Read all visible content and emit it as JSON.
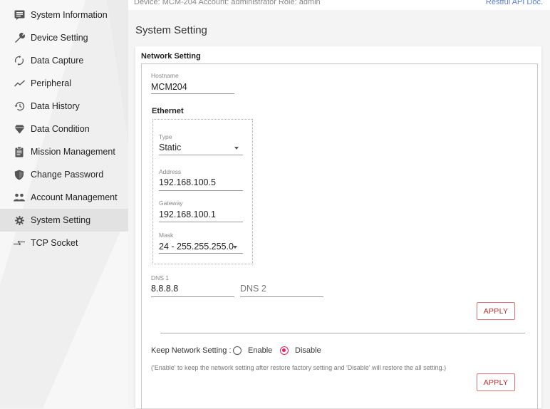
{
  "topbar": {
    "info": "Device: MCM-204   Account: administrator   Role: admin",
    "api_link": "Restful API Doc."
  },
  "sidebar": {
    "items": [
      {
        "label": "System Information",
        "icon": "info-panel-icon"
      },
      {
        "label": "Device Setting",
        "icon": "wrench-icon"
      },
      {
        "label": "Data Capture",
        "icon": "sync-icon"
      },
      {
        "label": "Peripheral",
        "icon": "line-chart-icon"
      },
      {
        "label": "Data History",
        "icon": "history-icon"
      },
      {
        "label": "Data Condition",
        "icon": "diamond-icon"
      },
      {
        "label": "Mission Management",
        "icon": "clipboard-icon"
      },
      {
        "label": "Change Password",
        "icon": "shield-icon"
      },
      {
        "label": "Account Management",
        "icon": "users-icon"
      },
      {
        "label": "System Setting",
        "icon": "gear-icon",
        "active": true
      },
      {
        "label": "TCP Socket",
        "icon": "arrows-icon"
      }
    ]
  },
  "page": {
    "title": "System Setting"
  },
  "network": {
    "section_title": "Network Setting",
    "hostname": {
      "label": "Hostname",
      "value": "MCM204"
    },
    "ethernet": {
      "title": "Ethernet",
      "type": {
        "label": "Type",
        "value": "Static"
      },
      "address": {
        "label": "Address",
        "value": "192.168.100.5"
      },
      "gateway": {
        "label": "Gateway",
        "value": "192.168.100.1"
      },
      "mask": {
        "label": "Mask",
        "value": "24 - 255.255.255.0"
      }
    },
    "dns1": {
      "label": "DNS 1",
      "value": "8.8.8.8"
    },
    "dns2": {
      "placeholder": "DNS 2"
    },
    "apply_label": "APPLY",
    "keep": {
      "label": "Keep Network Setting :",
      "enable_label": "Enable",
      "disable_label": "Disable",
      "selected": "Disable",
      "note": "('Enable' to keep the network setting after restore factory setting and 'Disable' will restore the all setting.)",
      "apply_label": "APPLY"
    }
  },
  "colors": {
    "accent": "#e91e63",
    "button_border": "#e57373",
    "link": "#5b7fd6"
  }
}
